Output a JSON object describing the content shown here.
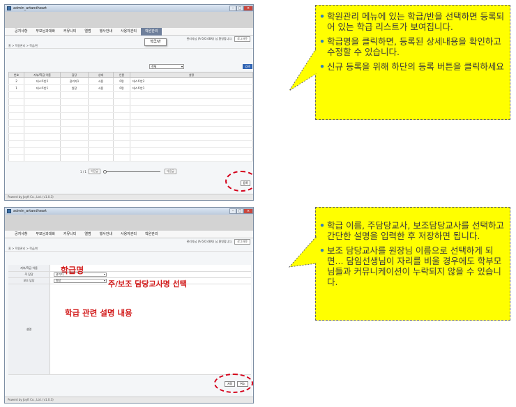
{
  "window_title": "admin_artandheart",
  "menu": [
    "공지사항",
    "부모님과대화",
    "커뮤니티",
    "앨범",
    "행사안내",
    "사용자관리",
    "학원관리"
  ],
  "submenu_item": "학급/반",
  "util_text": "관리자님 (A-5/0:48차) 님 환영합니다.",
  "logout_label": "로그아웃",
  "breadcrumb": "홈 > 학원관리 > 학급/반",
  "footer": "Powerd by Joyft Co., Ltd. (v1.0.3)",
  "list": {
    "filter_value": "전체",
    "search_label": "검색",
    "headers": [
      "번호",
      "지부/학급 이름",
      "담당",
      "상태",
      "인원",
      "설명"
    ],
    "rows": [
      [
        "2",
        "테스트반2",
        "관리자1",
        "사용",
        "0명",
        "테스트반2"
      ],
      [
        "1",
        "테스트반1",
        "원장",
        "사용",
        "0명",
        "테스트반1"
      ]
    ],
    "pager_text": "1 / 1",
    "prev_label": "이전글",
    "next_label": "다음글",
    "register_label": "등록"
  },
  "form": {
    "labels": [
      "지부/학급 이름",
      "주 담당",
      "보조 담당",
      "설명"
    ],
    "main_teacher": "관리자",
    "sub_teacher": "원장",
    "save_label": "저장",
    "cancel_label": "취소",
    "ann_name": "학급명",
    "ann_teacher": "주/보조 담당교사명 선택",
    "ann_desc": "학급 관련 설명 내용"
  },
  "callout_top": [
    "학원관리 메뉴에 있는 학급/반을 선택하면 등록되어 있는 학급 리스트가 보여집니다.",
    "학급명을 클릭하면, 등록된 상세내용을 확인하고 수정할 수 있습니다.",
    "신규 등록을 위해 하단의 등록 버튼을 클릭하세요"
  ],
  "callout_bottom": [
    "학급 이름, 주담당교사, 보조담당교사를 선택하고 간단한 설명을 입력한 후 저장하면 됩니다.",
    "보조 담당교사를 원장님 이름으로 선택하게 되면... 담임선생님이 자리를 비울 경우에도 학부모님들과 커뮤니케이션이 누락되지 않을 수 있습니다."
  ],
  "colors": {
    "callout_bg": "#ffff00",
    "highlight": "#d4001a",
    "active_menu": "#6e7f9b"
  }
}
